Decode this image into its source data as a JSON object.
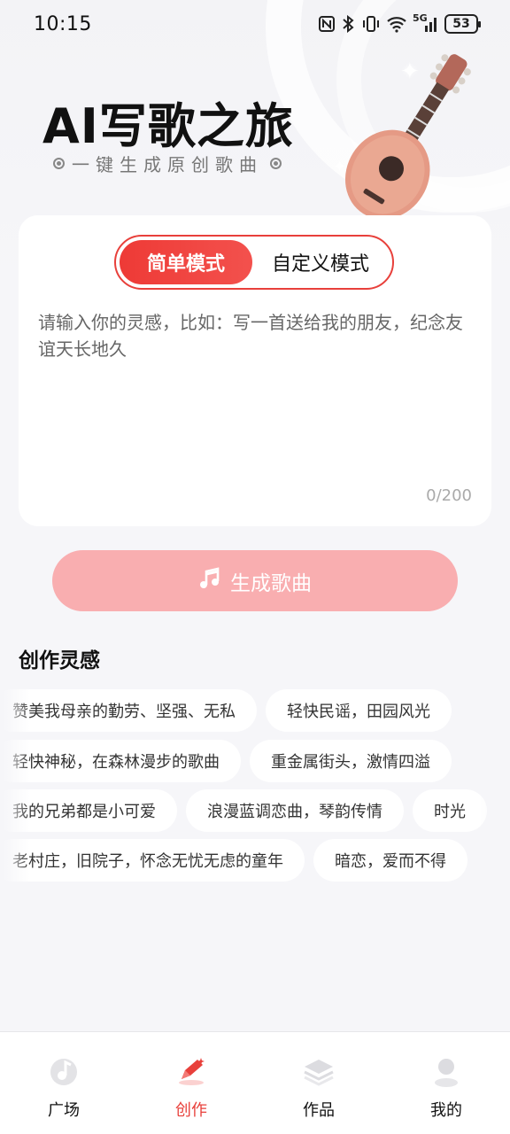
{
  "status_bar": {
    "time": "10:15",
    "icons": [
      "nfc-icon",
      "bluetooth-icon",
      "vibrate-icon",
      "wifi-icon",
      "signal-5g-icon",
      "battery-icon"
    ],
    "network_label": "5G",
    "battery_level": "53"
  },
  "hero": {
    "title": "AI写歌之旅",
    "subtitle": "一键生成原创歌曲"
  },
  "input_card": {
    "modes": [
      {
        "label": "简单模式",
        "active": true
      },
      {
        "label": "自定义模式",
        "active": false
      }
    ],
    "placeholder": "请输入你的灵感，比如：写一首送给我的朋友，纪念友谊天长地久",
    "char_count": "0/200"
  },
  "generate_button": {
    "label": "生成歌曲",
    "icon": "music-note-icon"
  },
  "inspiration": {
    "title": "创作灵感",
    "rows": [
      [
        "赞美我母亲的勤劳、坚强、无私",
        "轻快民谣，田园风光"
      ],
      [
        "轻快神秘，在森林漫步的歌曲",
        "重金属街头，激情四溢"
      ],
      [
        "我的兄弟都是小可爱",
        "浪漫蓝调恋曲，琴韵传情",
        "时光"
      ],
      [
        "老村庄，旧院子，怀念无忧无虑的童年",
        "暗恋，爱而不得"
      ]
    ]
  },
  "bottom_nav": [
    {
      "label": "广场",
      "icon": "music-disc-icon",
      "active": false
    },
    {
      "label": "创作",
      "icon": "pen-sparkle-icon",
      "active": true
    },
    {
      "label": "作品",
      "icon": "layers-icon",
      "active": false
    },
    {
      "label": "我的",
      "icon": "user-icon",
      "active": false
    }
  ],
  "colors": {
    "accent": "#e8403b",
    "button_disabled": "#f9aeb0",
    "background": "#f6f6f9"
  }
}
